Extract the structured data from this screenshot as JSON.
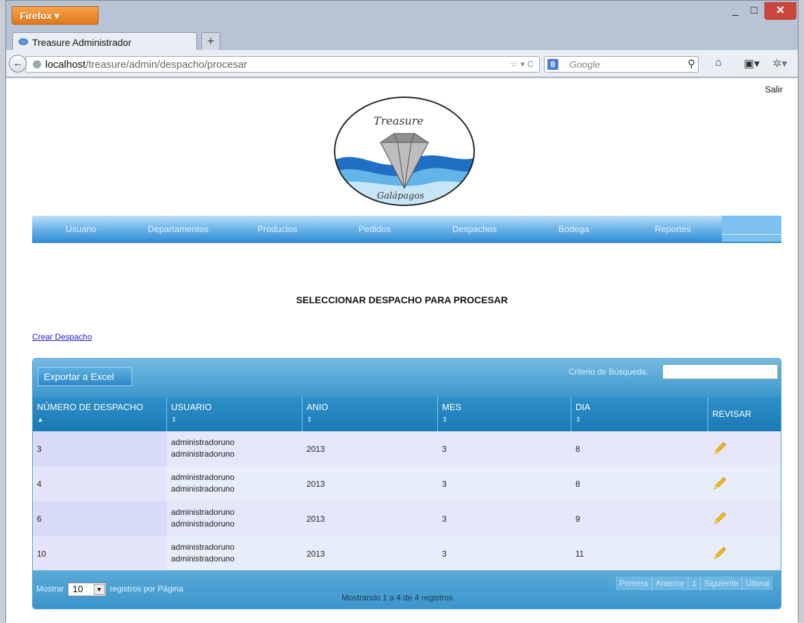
{
  "browser": {
    "app_button": "Firefox",
    "tab_title": "Treasure Administrador",
    "url_host": "localhost",
    "url_path": "/treasure/admin/despacho/procesar",
    "search_placeholder": "Google"
  },
  "page": {
    "logout": "Salir",
    "logo_text_top": "Treasure",
    "logo_text_bottom": "Galápagos",
    "menu": [
      "Usuario",
      "Departamentos",
      "Productos",
      "Pedidos",
      "Despachos",
      "Bodega",
      "Reportes"
    ],
    "heading": "SELECCIONAR DESPACHO PARA PROCESAR",
    "create_link": "Crear Despacho"
  },
  "table": {
    "export_button": "Exportar a Excel",
    "search_label": "Criterio de Búsqueda:",
    "search_value": "",
    "columns": [
      "NÚMERO DE DESPACHO",
      "USUARIO",
      "ANIO",
      "MES",
      "DIA",
      "REVISAR"
    ],
    "rows": [
      {
        "numero": "3",
        "usuario": [
          "administradoruno",
          "administradoruno"
        ],
        "anio": "2013",
        "mes": "3",
        "dia": "8"
      },
      {
        "numero": "4",
        "usuario": [
          "administradoruno",
          "administradoruno"
        ],
        "anio": "2013",
        "mes": "3",
        "dia": "8"
      },
      {
        "numero": "6",
        "usuario": [
          "administradoruno",
          "administradoruno"
        ],
        "anio": "2013",
        "mes": "3",
        "dia": "9"
      },
      {
        "numero": "10",
        "usuario": [
          "administradoruno",
          "administradoruno"
        ],
        "anio": "2013",
        "mes": "3",
        "dia": "11"
      }
    ],
    "length_prefix": "Mostrar",
    "length_value": "10",
    "length_suffix": "registros por Página",
    "info": "Mostrando 1 a 4 de 4 registros",
    "pager": [
      "Primera",
      "Anterior",
      "1",
      "Siguiente",
      "Última"
    ]
  }
}
